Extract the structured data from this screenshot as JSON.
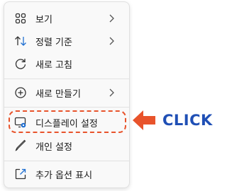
{
  "menu": {
    "items": [
      {
        "label": "보기",
        "icon": "grid-icon",
        "has_submenu": true
      },
      {
        "label": "정렬 기준",
        "icon": "sort-icon",
        "has_submenu": true
      },
      {
        "label": "새로 고침",
        "icon": "refresh-icon",
        "has_submenu": false
      },
      {
        "label": "새로 만들기",
        "icon": "add-circle-icon",
        "has_submenu": true
      },
      {
        "label": "디스플레이 설정",
        "icon": "display-settings-icon",
        "has_submenu": false
      },
      {
        "label": "개인 설정",
        "icon": "brush-icon",
        "has_submenu": false
      },
      {
        "label": "추가 옵션 표시",
        "icon": "open-external-icon",
        "has_submenu": false
      }
    ]
  },
  "callout": {
    "text": "CLICK",
    "arrow_color": "#e8532b",
    "text_color": "#1f4fb5"
  },
  "colors": {
    "highlight_border": "#e8532b",
    "accent": "#1f6fd1"
  }
}
